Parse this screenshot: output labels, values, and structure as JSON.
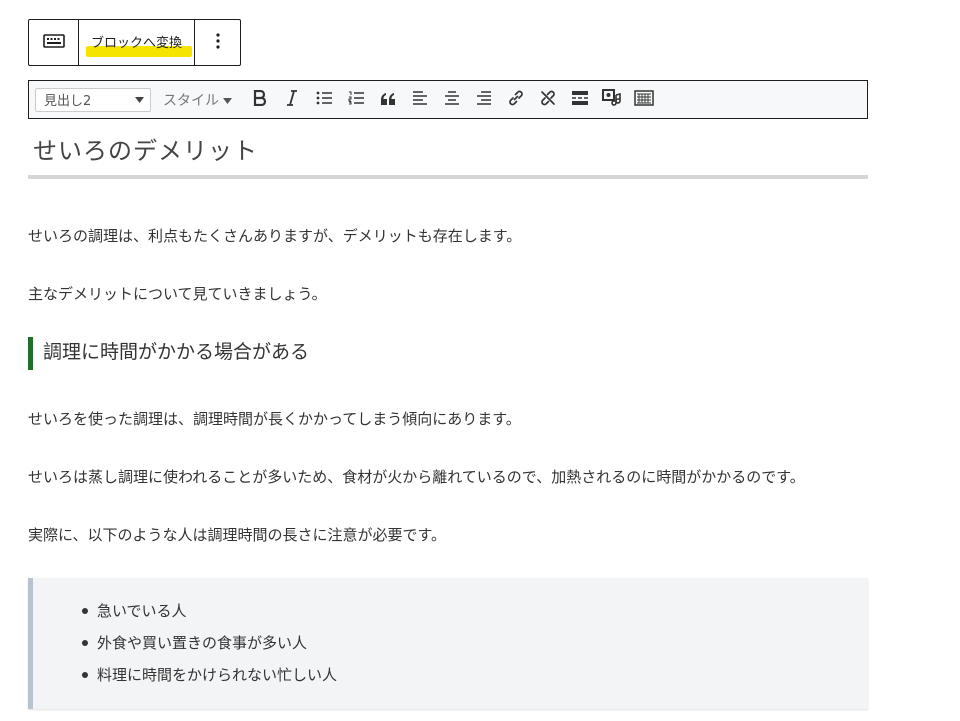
{
  "block_toolbar": {
    "keyboard_icon": "keyboard-icon",
    "convert_label": "ブロックへ変換",
    "highlight_color": "#f5e400",
    "more_icon": "vertical-ellipsis-icon"
  },
  "format_toolbar": {
    "heading_select": "見出し2",
    "style_select": "スタイル",
    "buttons": [
      {
        "name": "bold-button",
        "icon": "bold-icon"
      },
      {
        "name": "italic-button",
        "icon": "italic-icon"
      },
      {
        "name": "bullet-list-button",
        "icon": "bullet-list-icon"
      },
      {
        "name": "numbered-list-button",
        "icon": "numbered-list-icon"
      },
      {
        "name": "blockquote-button",
        "icon": "quote-icon"
      },
      {
        "name": "align-left-button",
        "icon": "align-left-icon"
      },
      {
        "name": "align-center-button",
        "icon": "align-center-icon"
      },
      {
        "name": "align-right-button",
        "icon": "align-right-icon"
      },
      {
        "name": "insert-link-button",
        "icon": "link-icon"
      },
      {
        "name": "remove-link-button",
        "icon": "unlink-icon"
      },
      {
        "name": "insert-more-button",
        "icon": "more-tag-icon"
      },
      {
        "name": "insert-media-button",
        "icon": "media-icon"
      },
      {
        "name": "toolbar-toggle-button",
        "icon": "keyboard-icon"
      }
    ]
  },
  "content": {
    "heading": "せいろのデメリット",
    "para1": "せいろの調理は、利点もたくさんありますが、デメリットも存在します。",
    "para2": "主なデメリットについて見ていきましょう。",
    "subheading": "調理に時間がかかる場合がある",
    "para3": "せいろを使った調理は、調理時間が長くかかってしまう傾向にあります。",
    "para4": "せいろは蒸し調理に使われることが多いため、食材が火から離れているので、加熱されるのに時間がかかるのです。",
    "para5": "実際に、以下のような人は調理時間の長さに注意が必要です。",
    "list": [
      "急いでいる人",
      "外食や買い置きの食事が多い人",
      "料理に時間をかけられない忙しい人"
    ],
    "accent_color": "#1f6e2a"
  }
}
